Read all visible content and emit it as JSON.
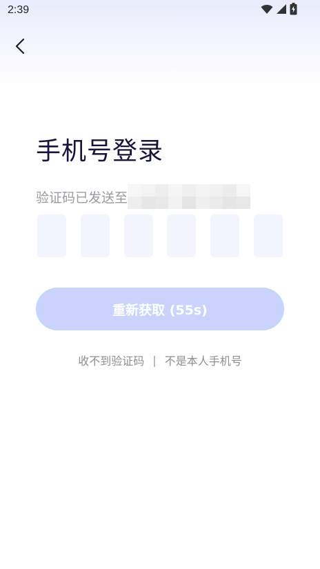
{
  "status_bar": {
    "time": "2:39",
    "icons": [
      "wifi-icon",
      "signal-icon",
      "battery-charging-icon"
    ]
  },
  "header": {
    "back_icon": "chevron-left-icon"
  },
  "main": {
    "title": "手机号登录",
    "sent_prefix": "验证码已发送至",
    "code_length": 6,
    "resend_label": "重新获取 (55s)",
    "help": {
      "no_code": "收不到验证码",
      "separator": "|",
      "not_my_phone": "不是本人手机号"
    }
  },
  "colors": {
    "title": "#15143a",
    "muted_text": "#9a9aa2",
    "code_box_bg": "#f2f5fd",
    "resend_button_bg": "#c9d3fb",
    "top_gradient": "#e8ebfb"
  }
}
